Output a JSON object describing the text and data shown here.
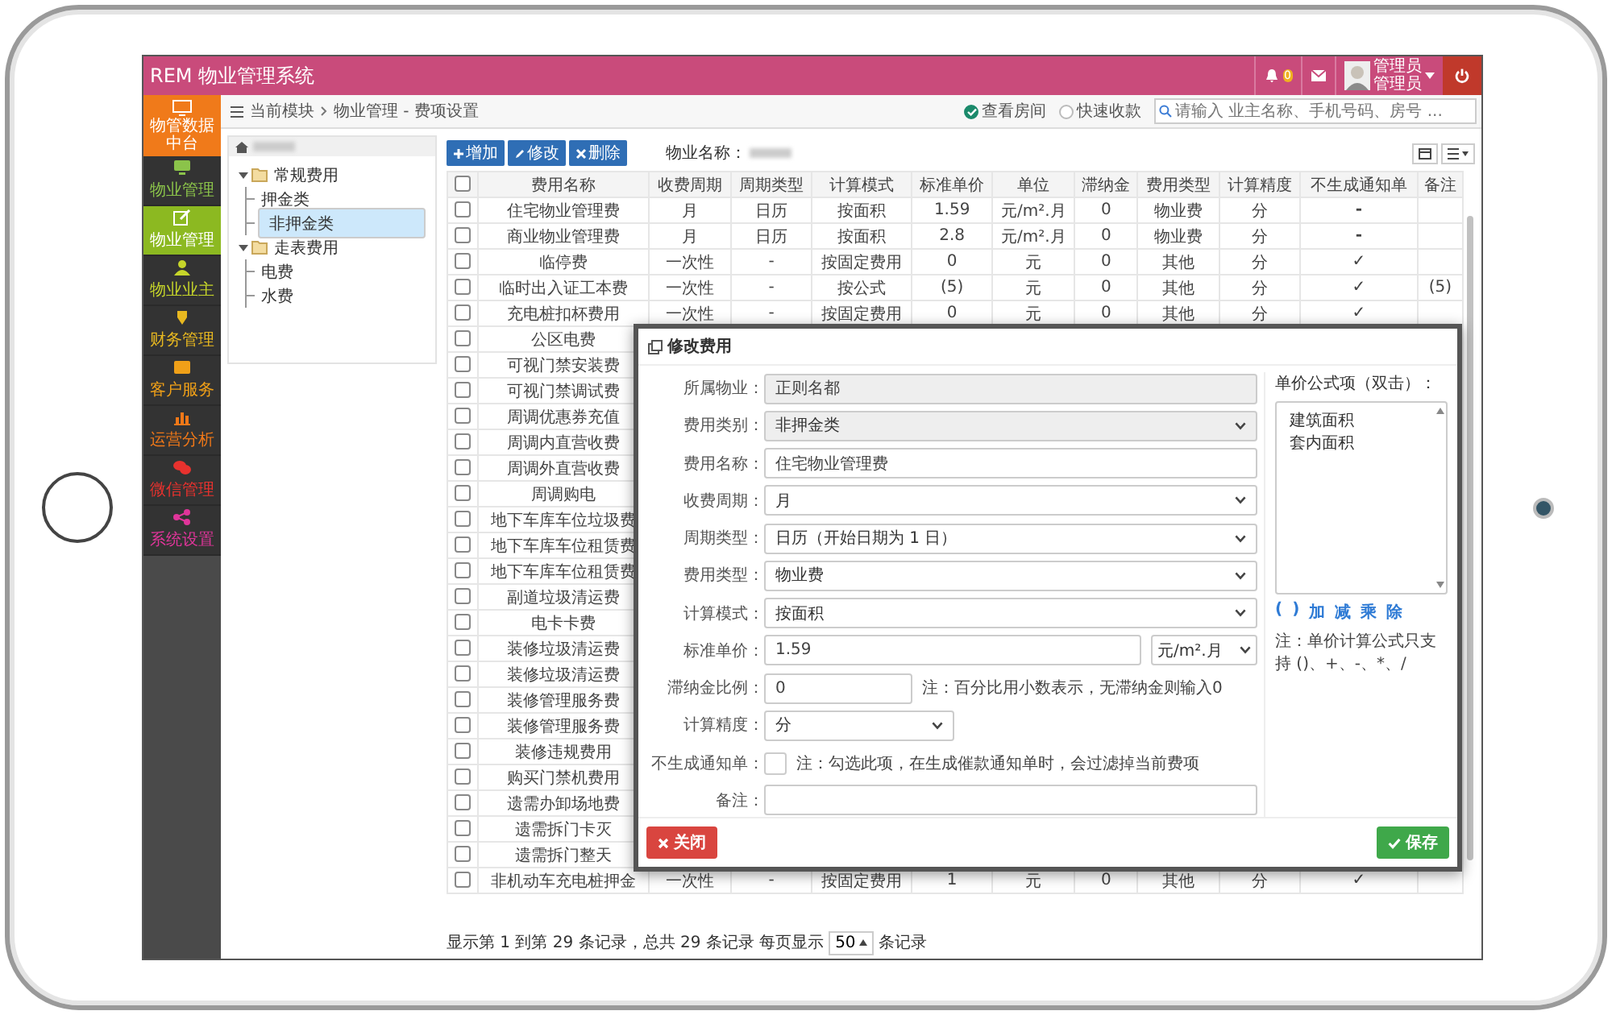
{
  "header": {
    "title": "REM 物业管理系统",
    "notification_count": "0",
    "user_lines": [
      "管理员",
      "管理员"
    ]
  },
  "sidebar": {
    "top": "物管数据中台",
    "items": [
      {
        "label": "物业管理",
        "color": "#8bc34a",
        "selected": false
      },
      {
        "label": "物业管理",
        "color": "#ffffff",
        "selected": true
      },
      {
        "label": "物业业主",
        "color": "#c6d52a",
        "selected": false
      },
      {
        "label": "财务管理",
        "color": "#e8b820",
        "selected": false
      },
      {
        "label": "客户服务",
        "color": "#f0a018",
        "selected": false
      },
      {
        "label": "运营分析",
        "color": "#f07818",
        "selected": false
      },
      {
        "label": "微信管理",
        "color": "#e8322e",
        "selected": false
      },
      {
        "label": "系统设置",
        "color": "#e0359a",
        "selected": false
      }
    ]
  },
  "breadcrumb": [
    "当前模块",
    "物业管理 - 费项设置"
  ],
  "view_options": [
    {
      "label": "查看房间",
      "selected": true
    },
    {
      "label": "快速收款",
      "selected": false
    }
  ],
  "search": {
    "placeholder": "请输入 业主名称、手机号码、房号 ..."
  },
  "tree": [
    {
      "label": "常规费用",
      "expanded": true,
      "children": [
        {
          "label": "押金类",
          "selected": false
        },
        {
          "label": "非押金类",
          "selected": true
        }
      ]
    },
    {
      "label": "走表费用",
      "expanded": true,
      "children": [
        {
          "label": "电费",
          "selected": false
        },
        {
          "label": "水费",
          "selected": false
        }
      ]
    }
  ],
  "toolbar": {
    "buttons": [
      "增加",
      "修改",
      "删除"
    ],
    "property_label": "物业名称："
  },
  "table": {
    "all_checked": false,
    "columns": [
      "费用名称",
      "收费周期",
      "周期类型",
      "计算模式",
      "标准单价",
      "单位",
      "滞纳金",
      "费用类型",
      "计算精度",
      "不生成通知单",
      "备注"
    ],
    "rows": [
      {
        "checked": false,
        "cells": [
          "住宅物业管理费",
          "月",
          "日历",
          "按面积",
          "1.59",
          "元/m².月",
          "0",
          "物业费",
          "分",
          "-",
          ""
        ]
      },
      {
        "checked": false,
        "cells": [
          "商业物业管理费",
          "月",
          "日历",
          "按面积",
          "2.8",
          "元/m².月",
          "0",
          "物业费",
          "分",
          "-",
          ""
        ]
      },
      {
        "checked": false,
        "cells": [
          "临停费",
          "一次性",
          "-",
          "按固定费用",
          "0",
          "元",
          "0",
          "其他",
          "分",
          "✓",
          ""
        ]
      },
      {
        "checked": false,
        "cells": [
          "临时出入证工本费",
          "一次性",
          "-",
          "按公式",
          "(5)",
          "元",
          "0",
          "其他",
          "分",
          "✓",
          "(5)"
        ]
      },
      {
        "checked": false,
        "cells": [
          "充电桩扣杯费用",
          "一次性",
          "-",
          "按固定费用",
          "0",
          "元",
          "0",
          "其他",
          "分",
          "✓",
          ""
        ]
      },
      {
        "checked": false,
        "cells": [
          "公区电费"
        ]
      },
      {
        "checked": false,
        "cells": [
          "可视门禁安装费"
        ]
      },
      {
        "checked": false,
        "cells": [
          "可视门禁调试费"
        ]
      },
      {
        "checked": false,
        "cells": [
          "周调优惠券充值"
        ]
      },
      {
        "checked": false,
        "cells": [
          "周调内直营收费"
        ]
      },
      {
        "checked": false,
        "cells": [
          "周调外直营收费"
        ]
      },
      {
        "checked": false,
        "cells": [
          "周调购电"
        ]
      },
      {
        "checked": false,
        "cells": [
          "地下车库车位垃圾费"
        ]
      },
      {
        "checked": false,
        "cells": [
          "地下车库车位租赁费"
        ]
      },
      {
        "checked": false,
        "cells": [
          "地下车库车位租赁费"
        ]
      },
      {
        "checked": false,
        "cells": [
          "副道垃圾清运费"
        ]
      },
      {
        "checked": false,
        "cells": [
          "电卡卡费"
        ]
      },
      {
        "checked": false,
        "cells": [
          "装修垃圾清运费"
        ]
      },
      {
        "checked": false,
        "cells": [
          "装修垃圾清运费"
        ]
      },
      {
        "checked": false,
        "cells": [
          "装修管理服务费"
        ]
      },
      {
        "checked": false,
        "cells": [
          "装修管理服务费"
        ]
      },
      {
        "checked": false,
        "cells": [
          "装修违规费用"
        ]
      },
      {
        "checked": false,
        "cells": [
          "购买门禁机费用"
        ]
      },
      {
        "checked": false,
        "cells": [
          "遗需办卸场地费"
        ]
      },
      {
        "checked": false,
        "cells": [
          "遗需拆门卡灭"
        ]
      },
      {
        "checked": false,
        "cells": [
          "遗需拆门整天"
        ]
      },
      {
        "checked": false,
        "cells": [
          "非机动车充电桩押金",
          "一次性",
          "-",
          "按固定费用",
          "1",
          "元",
          "0",
          "其他",
          "分",
          "✓",
          ""
        ]
      }
    ]
  },
  "footer": {
    "before": "显示第 1 到第 29 条记录，总共 29 条记录 每页显示",
    "page_size": "50",
    "after": "条记录"
  },
  "modal": {
    "title": "修改费用",
    "fields": [
      {
        "label": "所属物业：",
        "kind": "input",
        "value": "正则名都",
        "disabled": true
      },
      {
        "label": "费用类别：",
        "kind": "select",
        "value": "非押金类",
        "disabled": true
      },
      {
        "label": "费用名称：",
        "kind": "input",
        "value": "住宅物业管理费",
        "disabled": false
      },
      {
        "label": "收费周期：",
        "kind": "select",
        "value": "月",
        "disabled": false
      },
      {
        "label": "周期类型：",
        "kind": "select",
        "value": "日历（开始日期为 1 日）",
        "disabled": false
      },
      {
        "label": "费用类型：",
        "kind": "select",
        "value": "物业费",
        "disabled": false
      },
      {
        "label": "计算模式：",
        "kind": "select",
        "value": "按面积",
        "disabled": false
      },
      {
        "label": "标准单价：",
        "kind": "input_unit",
        "value": "1.59",
        "unit": "元/m².月",
        "disabled": false
      },
      {
        "label": "滞纳金比例：",
        "kind": "input_note",
        "value": "0",
        "note": "注：百分比用小数表示，无滞纳金则输入0",
        "disabled": false
      },
      {
        "label": "计算精度：",
        "kind": "select_short",
        "value": "分",
        "disabled": false
      },
      {
        "label": "不生成通知单：",
        "kind": "checkbox",
        "checked": false,
        "note": "注：勾选此项，在生成催款通知单时，会过滤掉当前费项",
        "disabled": false
      },
      {
        "label": "备注：",
        "kind": "input",
        "disabled": false
      }
    ],
    "formula_label": "单价公式项（双击）：",
    "formula_items": [
      "建筑面积",
      "套内面积"
    ],
    "operators": [
      "(",
      ")",
      "加",
      "减",
      "乘",
      "除"
    ],
    "formula_note": "注：单价计算公式只支持 ()、+、-、*、/",
    "close": "关闭",
    "save": "保存"
  }
}
